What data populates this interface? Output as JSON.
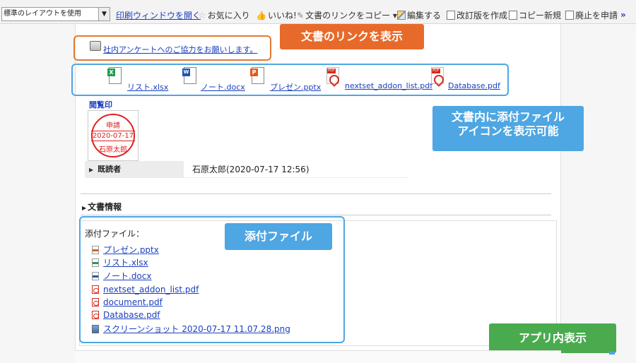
{
  "toolbar": {
    "layout_select": "標準のレイアウトを使用",
    "print": "印刷ウィンドウを開く",
    "favorite": "お気に入り",
    "like": "いいね!",
    "copy_link": "文書のリンクをコピー",
    "edit": "編集する",
    "revise": "改訂版を作成",
    "copy_new": "コピー新規",
    "retire": "廃止を申請",
    "more": "»"
  },
  "notice": {
    "link": "社内アンケートへのご協力をお願いします。"
  },
  "callouts": {
    "doc_link": "文書のリンクを表示",
    "attach_icons_line1": "文書内に添付ファイル",
    "attach_icons_line2": "アイコンを表示可能",
    "attachments": "添付ファイル",
    "in_app": "アプリ内表示"
  },
  "icon_row": [
    {
      "name": "リスト.xlsx",
      "type": "xlsx"
    },
    {
      "name": "ノート.docx",
      "type": "docx"
    },
    {
      "name": "プレゼン.pptx",
      "type": "pptx"
    },
    {
      "name": "nextset_addon_list.pdf",
      "type": "pdf"
    },
    {
      "name": "Database.pdf",
      "type": "pdf"
    }
  ],
  "approval": {
    "title": "閲覧印",
    "stamp_top": "申請",
    "stamp_date": "2020-07-17",
    "stamp_name": "石原太郎",
    "reader_label": "既読者",
    "reader_value": "石原太郎(2020-07-17 12:56)"
  },
  "doc_info": {
    "title": "文書情報",
    "attach_label": "添付ファイル：",
    "files": [
      {
        "name": "プレゼン.pptx",
        "type": "pptx"
      },
      {
        "name": "リスト.xlsx",
        "type": "xlsx"
      },
      {
        "name": "ノート.docx",
        "type": "docx"
      },
      {
        "name": "nextset_addon_list.pdf",
        "type": "pdf"
      },
      {
        "name": "document.pdf",
        "type": "pdf"
      },
      {
        "name": "Database.pdf",
        "type": "pdf"
      },
      {
        "name": "スクリーンショット 2020-07-17 11.07.28.png",
        "type": "png"
      }
    ]
  },
  "colors": {
    "link": "#1a3fbf",
    "callout_orange": "#e86a2a",
    "callout_blue": "#4ea6e3",
    "callout_green": "#4aab4e",
    "stamp_red": "#e02020"
  }
}
